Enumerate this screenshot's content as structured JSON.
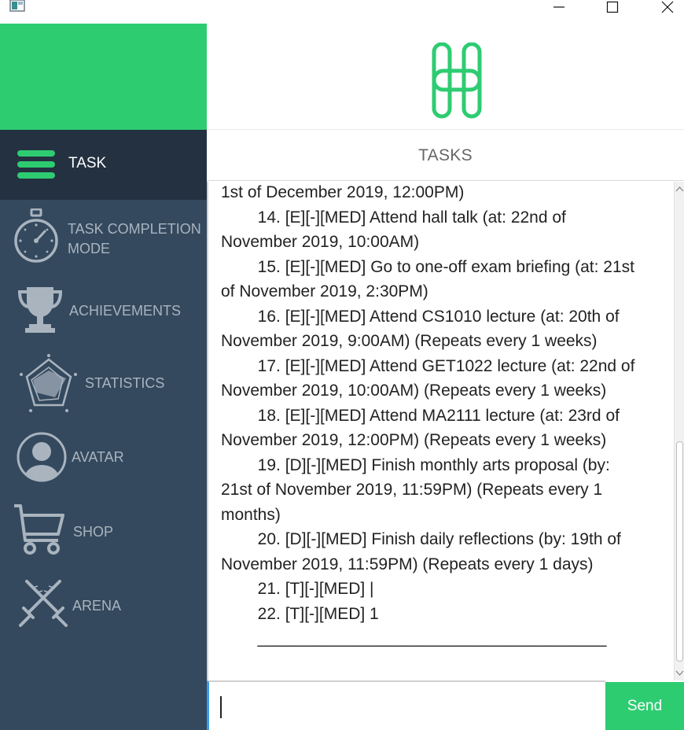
{
  "window": {
    "minimize_icon": "minimize-icon",
    "maximize_icon": "maximize-icon",
    "close_icon": "close-icon"
  },
  "colors": {
    "brand_green": "#2ecc71",
    "sidebar_bg": "#34495e",
    "sidebar_active_bg": "#233140",
    "sidebar_text": "#a9b4bf"
  },
  "sidebar": {
    "items": [
      {
        "label": "TASK",
        "icon": "hamburger-menu-icon",
        "active": true
      },
      {
        "label": "TASK COMPLETION\nMODE",
        "icon": "stopwatch-icon",
        "active": false
      },
      {
        "label": "ACHIEVEMENTS",
        "icon": "trophy-icon",
        "active": false
      },
      {
        "label": "STATISTICS",
        "icon": "radar-chart-icon",
        "active": false
      },
      {
        "label": "AVATAR",
        "icon": "avatar-icon",
        "active": false
      },
      {
        "label": "SHOP",
        "icon": "shopping-cart-icon",
        "active": false
      },
      {
        "label": "ARENA",
        "icon": "crossed-swords-icon",
        "active": false
      }
    ]
  },
  "header": {
    "logo_icon": "h-logo-icon",
    "section_title": "TASKS"
  },
  "tasks": {
    "lines": [
      "1st of December 2019, 12:00PM)",
      "        14. [E][-][MED] Attend hall talk (at: 22nd of",
      "November 2019, 10:00AM)",
      "        15. [E][-][MED] Go to one-off exam briefing (at: 21st",
      "of November 2019, 2:30PM)",
      "        16. [E][-][MED] Attend CS1010 lecture (at: 20th of",
      "November 2019, 9:00AM) (Repeats every 1 weeks)",
      "        17. [E][-][MED] Attend GET1022 lecture (at: 22nd of",
      "November 2019, 10:00AM) (Repeats every 1 weeks)",
      "        18. [E][-][MED] Attend MA2111 lecture (at: 23rd of",
      "November 2019, 12:00PM) (Repeats every 1 weeks)",
      "        19. [D][-][MED] Finish monthly arts proposal (by:",
      "21st of November 2019, 11:59PM) (Repeats every 1",
      "months)",
      "        20. [D][-][MED] Finish daily reflections (by: 19th of",
      "November 2019, 11:59PM) (Repeats every 1 days)",
      "        21. [T][-][MED] |",
      "        22. [T][-][MED] 1",
      "        ______________________________________"
    ]
  },
  "input": {
    "value": "",
    "send_label": "Send"
  }
}
